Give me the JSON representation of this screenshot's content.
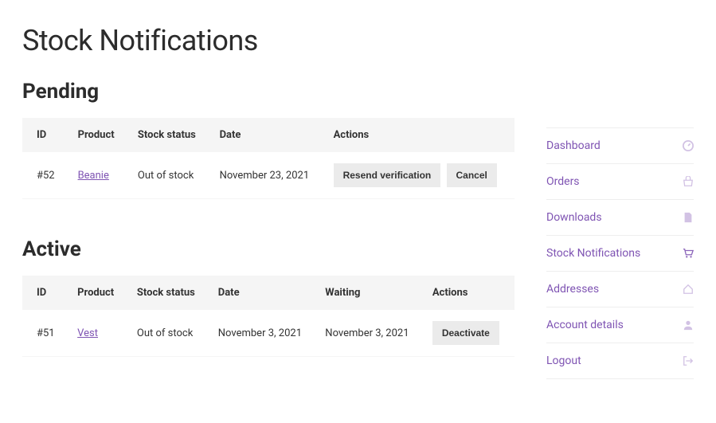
{
  "page_title": "Stock Notifications",
  "pending": {
    "heading": "Pending",
    "columns": {
      "id": "ID",
      "product": "Product",
      "stock_status": "Stock status",
      "date": "Date",
      "actions": "Actions"
    },
    "rows": [
      {
        "id": "#52",
        "product": "Beanie",
        "stock_status": "Out of stock",
        "date": "November 23, 2021",
        "actions": {
          "resend": "Resend verification",
          "cancel": "Cancel"
        }
      }
    ]
  },
  "active": {
    "heading": "Active",
    "columns": {
      "id": "ID",
      "product": "Product",
      "stock_status": "Stock status",
      "date": "Date",
      "waiting": "Waiting",
      "actions": "Actions"
    },
    "rows": [
      {
        "id": "#51",
        "product": "Vest",
        "stock_status": "Out of stock",
        "date": "November 3, 2021",
        "waiting": "November 3, 2021",
        "actions": {
          "deactivate": "Deactivate"
        }
      }
    ]
  },
  "sidebar": {
    "items": [
      {
        "label": "Dashboard",
        "icon": "dashboard-icon",
        "current": false
      },
      {
        "label": "Orders",
        "icon": "basket-icon",
        "current": false
      },
      {
        "label": "Downloads",
        "icon": "file-icon",
        "current": false
      },
      {
        "label": "Stock Notifications",
        "icon": "cart-icon",
        "current": true
      },
      {
        "label": "Addresses",
        "icon": "home-icon",
        "current": false
      },
      {
        "label": "Account details",
        "icon": "user-icon",
        "current": false
      },
      {
        "label": "Logout",
        "icon": "logout-icon",
        "current": false
      }
    ]
  }
}
